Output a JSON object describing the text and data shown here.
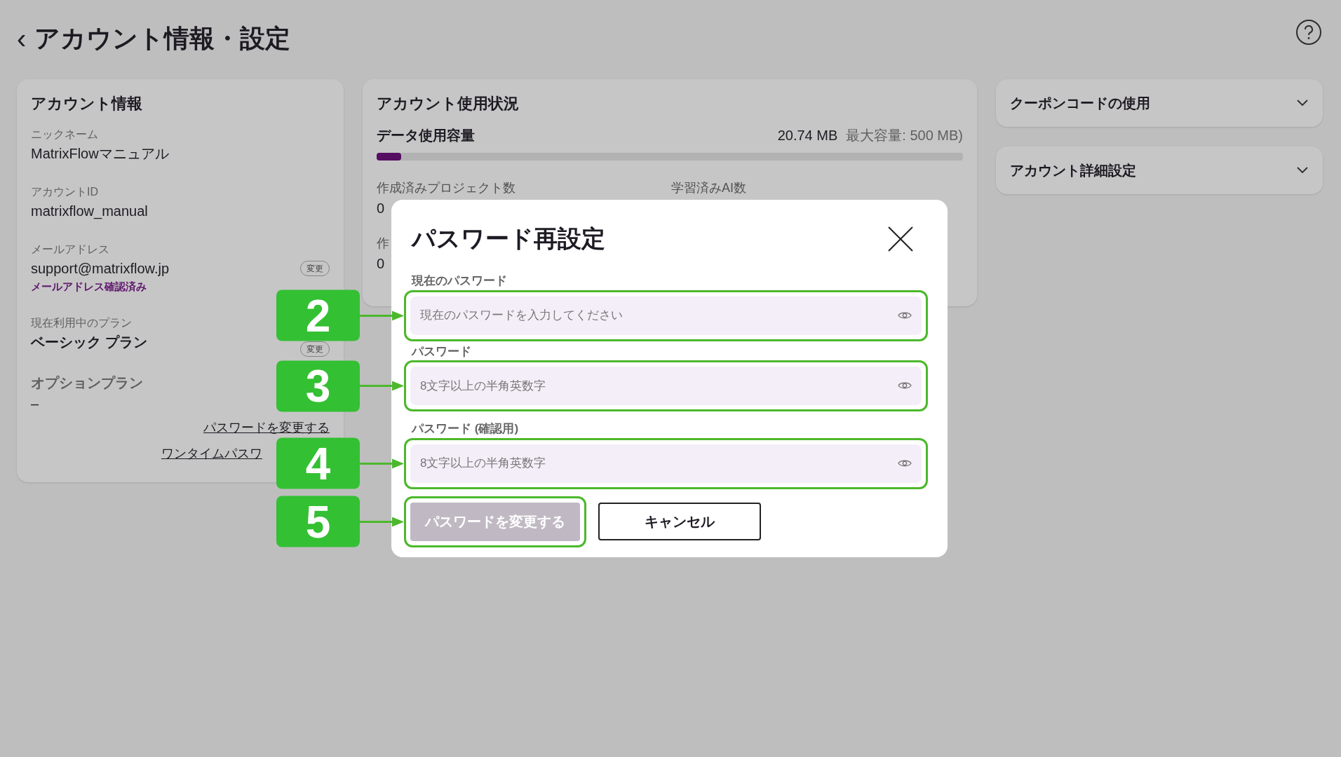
{
  "page": {
    "back": "‹",
    "title": "アカウント情報・設定"
  },
  "account_card": {
    "title": "アカウント情報",
    "fields": [
      {
        "kind": "text",
        "label": "ニックネーム",
        "value": "MatrixFlowマニュアル"
      },
      {
        "kind": "text",
        "label": "アカウントID",
        "value": "matrixflow_manual"
      },
      {
        "kind": "email",
        "label": "メールアドレス",
        "value": "support@matrixflow.jp",
        "button": "変更",
        "note": "メールアドレス確認済み"
      },
      {
        "kind": "plan",
        "label": "現在利用中のプラン",
        "value": "ベーシック プラン",
        "button": "変更"
      },
      {
        "kind": "option",
        "label": "オプションプラン",
        "value": "–"
      }
    ],
    "links": [
      "パスワードを変更する",
      "ワンタイムパスワ"
    ]
  },
  "usage_card": {
    "title": "アカウント使用状況",
    "data_label": "データ使用容量",
    "used": "20.74 MB",
    "max": "最大容量: 500 MB)",
    "level": 0.042,
    "stats": [
      {
        "label": "作成済みプロジェクト数",
        "value": "0"
      },
      {
        "label": "学習済みAI数"
      },
      {
        "label": "作",
        "value": "0"
      }
    ]
  },
  "side_panels": [
    {
      "title": "クーポンコードの使用",
      "expanded": false
    },
    {
      "title": "アカウント詳細設定",
      "expanded": false
    }
  ],
  "modal": {
    "title": "パスワード再設定",
    "fields": [
      {
        "label": "現在のパスワード",
        "placeholder": "現在のパスワードを入力してください",
        "callout": "2"
      },
      {
        "label": "パスワード",
        "placeholder": "8文字以上の半角英数字",
        "callout": "3"
      },
      {
        "label": "パスワード (確認用)",
        "placeholder": "8文字以上の半角英数字",
        "callout": "4"
      }
    ],
    "submit": {
      "label": "パスワードを変更する",
      "disabled": true,
      "callout": "5"
    },
    "cancel": "キャンセル"
  }
}
